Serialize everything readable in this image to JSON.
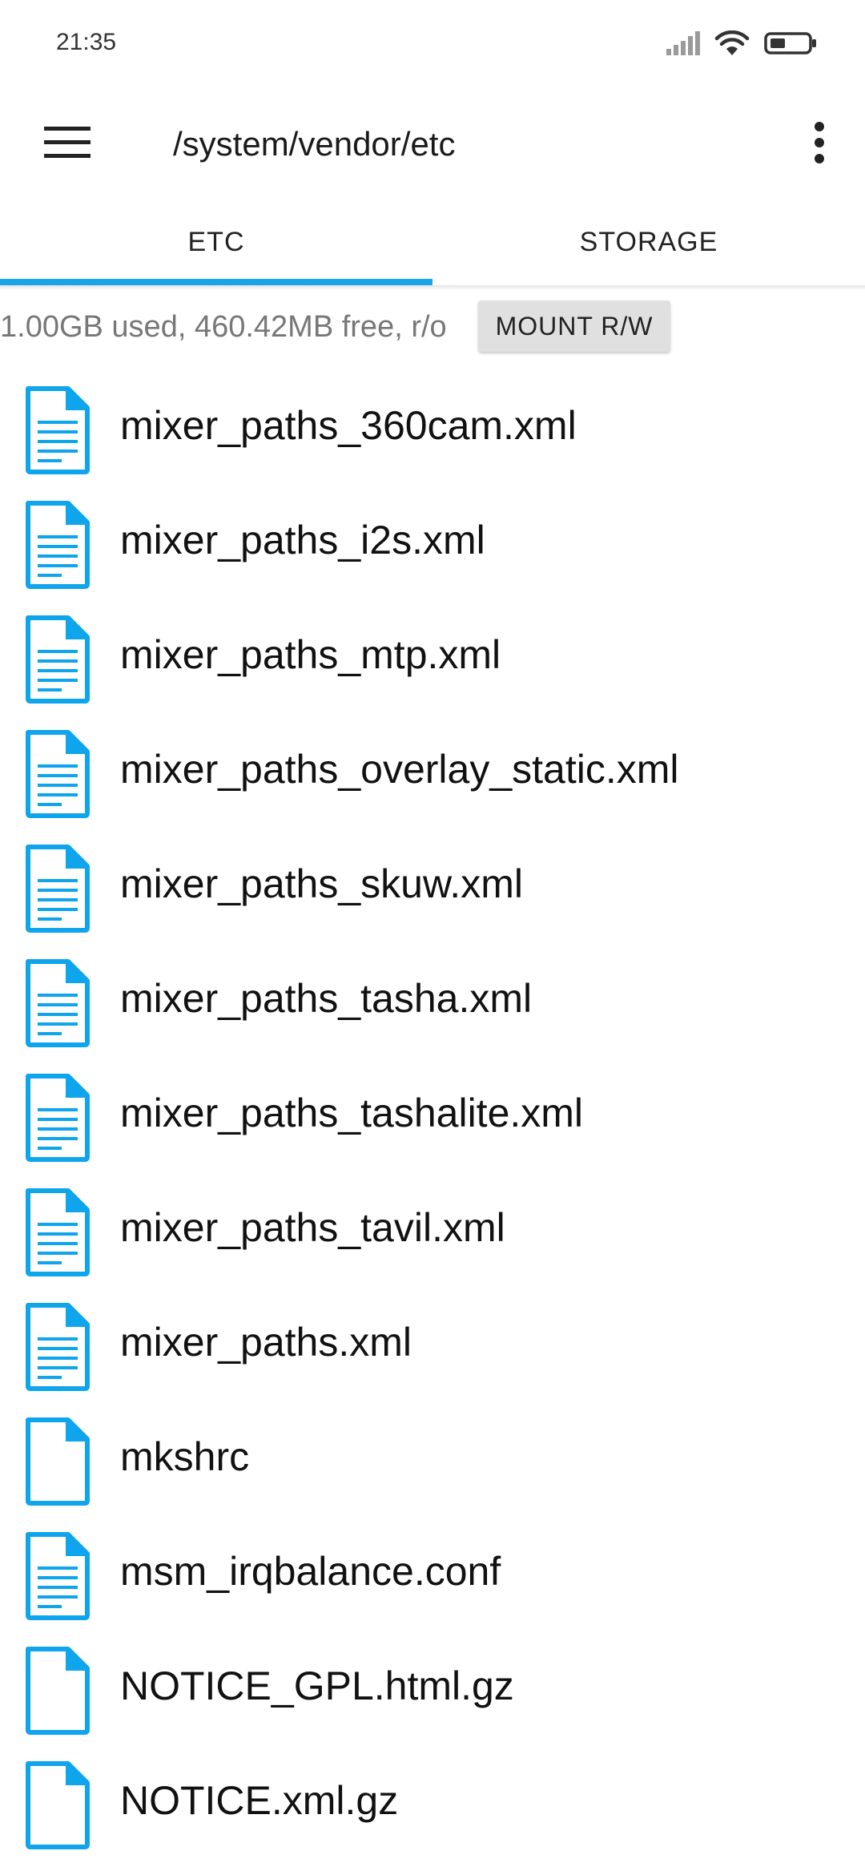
{
  "status_bar": {
    "time": "21:35",
    "icons": [
      "signal-icon",
      "wifi-icon",
      "battery-icon"
    ]
  },
  "toolbar": {
    "menu_icon": "hamburger-menu-icon",
    "path": "/system/vendor/etc",
    "overflow_icon": "more-vert-icon"
  },
  "tabs": [
    {
      "label": "ETC",
      "selected": true
    },
    {
      "label": "STORAGE",
      "selected": false
    }
  ],
  "storage": {
    "info": "1.00GB used, 460.42MB free, r/o",
    "mount_button": "MOUNT R/W"
  },
  "colors": {
    "accent": "#1aa3e8",
    "icon_blue": "#0ea5ec"
  },
  "files": [
    {
      "name": "mixer_paths_360cam.xml",
      "icon": "text-file-icon"
    },
    {
      "name": "mixer_paths_i2s.xml",
      "icon": "text-file-icon"
    },
    {
      "name": "mixer_paths_mtp.xml",
      "icon": "text-file-icon"
    },
    {
      "name": "mixer_paths_overlay_static.xml",
      "icon": "text-file-icon"
    },
    {
      "name": "mixer_paths_skuw.xml",
      "icon": "text-file-icon"
    },
    {
      "name": "mixer_paths_tasha.xml",
      "icon": "text-file-icon"
    },
    {
      "name": "mixer_paths_tashalite.xml",
      "icon": "text-file-icon"
    },
    {
      "name": "mixer_paths_tavil.xml",
      "icon": "text-file-icon"
    },
    {
      "name": "mixer_paths.xml",
      "icon": "text-file-icon"
    },
    {
      "name": "mkshrc",
      "icon": "blank-file-icon"
    },
    {
      "name": "msm_irqbalance.conf",
      "icon": "text-file-icon"
    },
    {
      "name": "NOTICE_GPL.html.gz",
      "icon": "blank-file-icon"
    },
    {
      "name": "NOTICE.xml.gz",
      "icon": "blank-file-icon"
    }
  ]
}
